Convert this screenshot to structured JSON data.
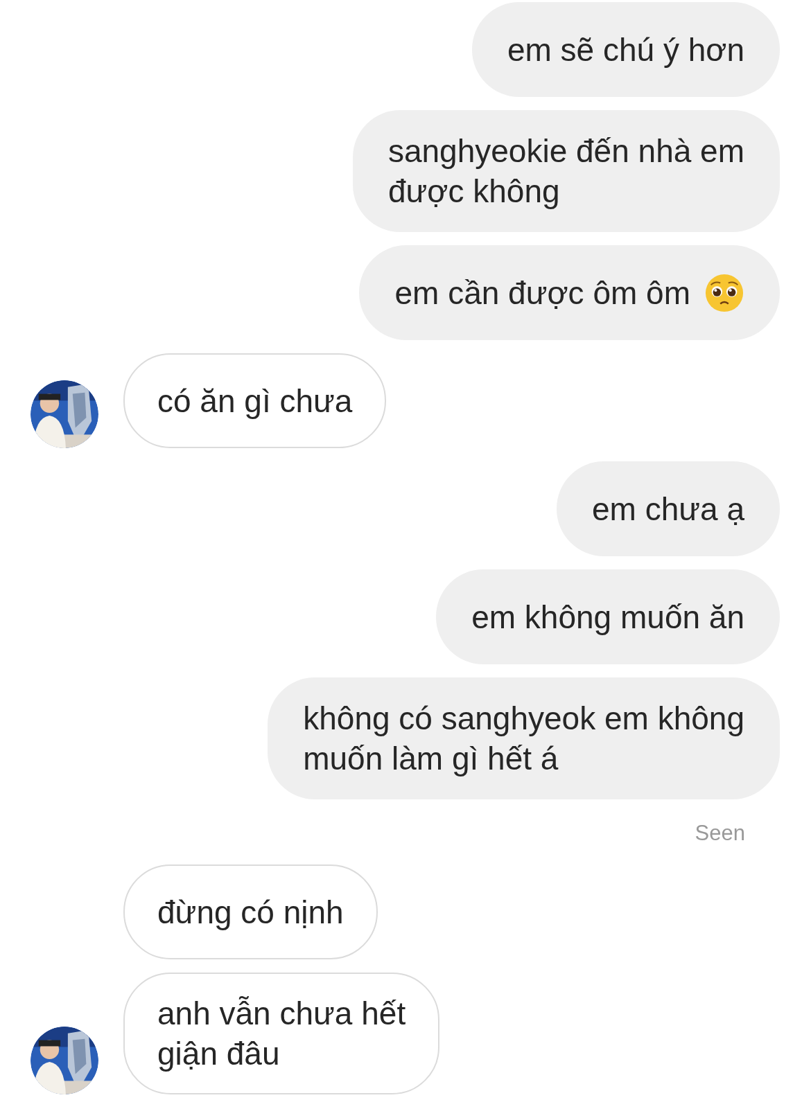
{
  "messages": [
    {
      "kind": "sent",
      "lines": [
        "em sẽ chú ý hơn"
      ],
      "has_emoji": false
    },
    {
      "kind": "sent",
      "lines": [
        "sanghyeokie đến nhà em",
        "được không"
      ],
      "has_emoji": false
    },
    {
      "kind": "sent",
      "lines": [
        "em cần được ôm ôm"
      ],
      "has_emoji": true
    },
    {
      "kind": "received",
      "lines": [
        "có ăn gì chưa"
      ],
      "avatar": true
    },
    {
      "kind": "sent",
      "lines": [
        "em chưa ạ"
      ],
      "has_emoji": false
    },
    {
      "kind": "sent",
      "lines": [
        "em không muốn ăn"
      ],
      "has_emoji": false
    },
    {
      "kind": "sent",
      "lines": [
        "không có sanghyeok em không",
        "muốn làm gì hết á"
      ],
      "has_emoji": false
    },
    {
      "kind": "status",
      "text": "Seen"
    },
    {
      "kind": "received",
      "lines": [
        "đừng có nịnh"
      ],
      "avatar": false
    },
    {
      "kind": "received",
      "lines": [
        "anh vẫn chưa hết",
        "giận đâu"
      ],
      "avatar": true
    }
  ]
}
